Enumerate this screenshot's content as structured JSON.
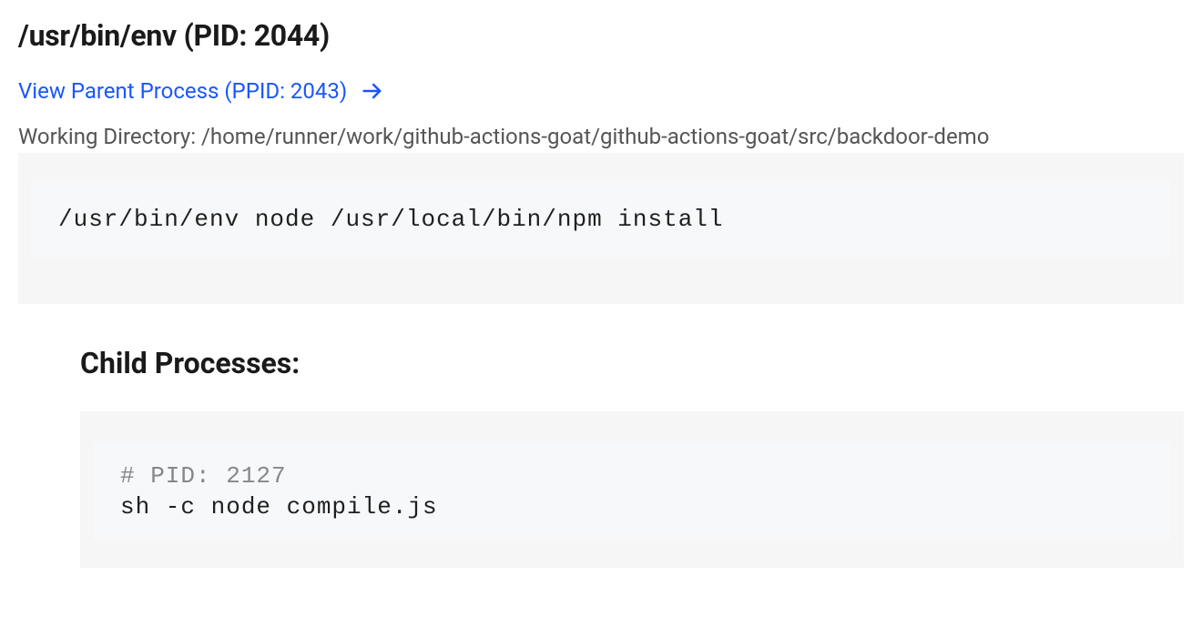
{
  "header": {
    "title": "/usr/bin/env (PID: 2044)"
  },
  "parent": {
    "label": "View Parent Process (PPID: 2043)"
  },
  "working_directory": {
    "label_and_value": "Working Directory: /home/runner/work/github-actions-goat/github-actions-goat/src/backdoor-demo"
  },
  "command": {
    "text": "/usr/bin/env node /usr/local/bin/npm install"
  },
  "children": {
    "heading": "Child Processes:",
    "items": [
      {
        "pid_line": "# PID: 2127",
        "cmd_line": "sh -c node compile.js"
      }
    ]
  }
}
